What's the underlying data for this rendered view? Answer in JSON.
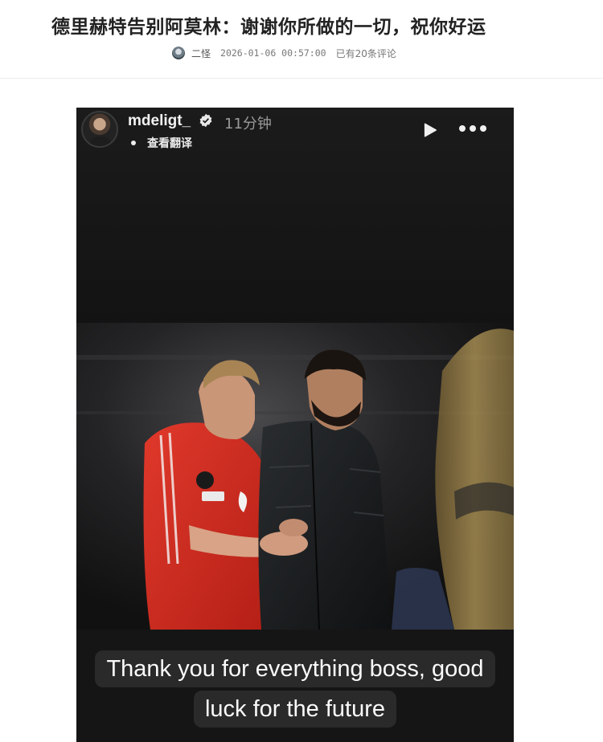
{
  "article": {
    "title": "德里赫特告别阿莫林：谢谢你所做的一切，祝你好运",
    "author": "二怪",
    "datetime": "2026-01-06 00:57:00",
    "comments": "已有20条评论"
  },
  "story": {
    "username": "mdeligt_",
    "time_ago": "11分钟",
    "translate_label": "查看翻译",
    "caption_line1": "Thank you for everything boss, good",
    "caption_line2": "luck for the future",
    "background_color": "#151515",
    "caption_bg_color": "#2a2a2a",
    "icons": [
      "verified-icon",
      "play-icon",
      "more-icon"
    ]
  }
}
